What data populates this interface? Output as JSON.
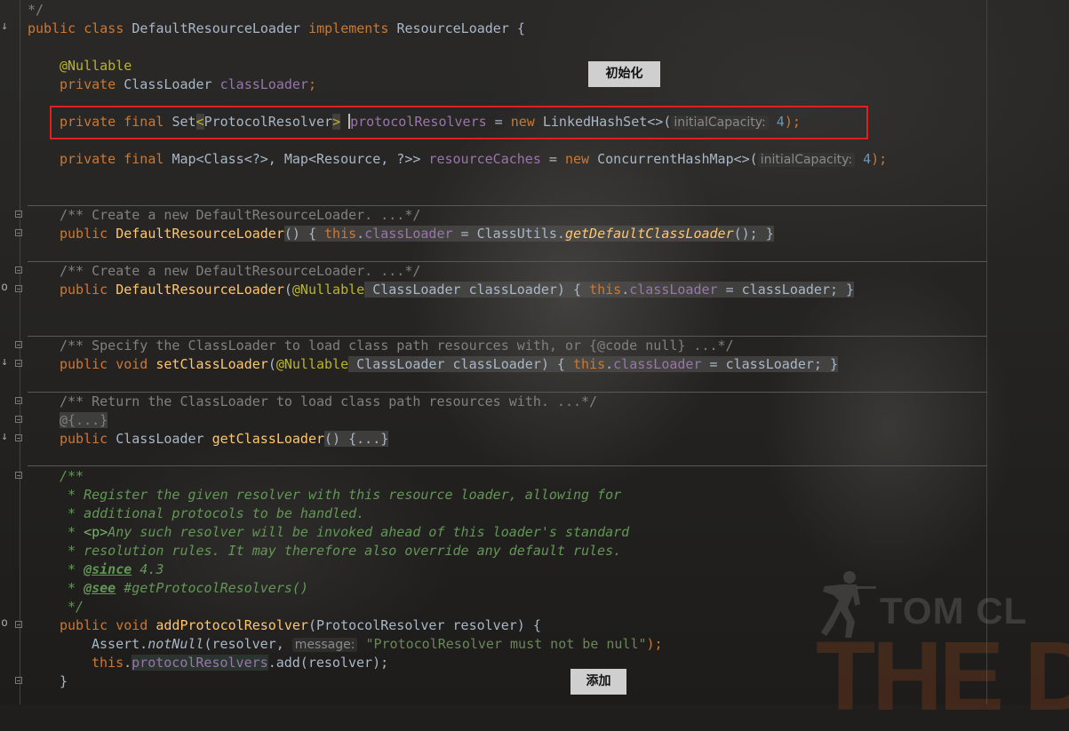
{
  "editor": {
    "lines": {
      "l00": "*/",
      "l01": [
        "public ",
        "class ",
        "DefaultResourceLoader ",
        "implements ",
        "ResourceLoader {"
      ],
      "l02": "@Nullable",
      "l03": [
        "private ",
        "ClassLoader ",
        "classLoader",
        ";"
      ],
      "l04": [
        "private final ",
        "Set",
        "<",
        "ProtocolResolver",
        ">",
        " ",
        "protocolResolvers",
        " = ",
        "new ",
        "LinkedHashSet<>(",
        "initialCapacity:",
        " 4",
        ");"
      ],
      "l05": [
        "private final ",
        "Map<Class<?>, Map<Resource, ?>> ",
        "resourceCaches",
        " = ",
        "new ",
        "ConcurrentHashMap<>(",
        "initialCapacity:",
        " 4",
        ");"
      ],
      "l06": "/** Create a new DefaultResourceLoader. ...*/",
      "l07": [
        "public ",
        "DefaultResourceLoader",
        "() { ",
        "this",
        ".",
        "classLoader",
        " = ClassUtils.",
        "getDefaultClassLoader",
        "(); }"
      ],
      "l08": "/** Create a new DefaultResourceLoader. ...*/",
      "l09": [
        "public ",
        "DefaultResourceLoader",
        "(",
        "@Nullable",
        " ClassLoader classLoader) { ",
        "this",
        ".",
        "classLoader",
        " = classLoader; }"
      ],
      "l10": "/** Specify the ClassLoader to load class path resources with, or {@code null} ...*/",
      "l11": [
        "public void ",
        "setClassLoader",
        "(",
        "@Nullable",
        " ClassLoader classLoader) { ",
        "this",
        ".",
        "classLoader",
        " = classLoader; }"
      ],
      "l12": "/** Return the ClassLoader to load class path resources with. ...*/",
      "l13": "@{...}",
      "l14": [
        "public ",
        "ClassLoader ",
        "getClassLoader",
        "() {...}"
      ],
      "l15": "/**",
      "l16": " * Register the given resolver with this resource loader, allowing for",
      "l17": " * additional protocols to be handled.",
      "l18": [
        " * ",
        "<p>",
        "Any such resolver will be invoked ahead of this loader's standard"
      ],
      "l19": " * resolution rules. It may therefore also override any default rules.",
      "l20": [
        " * ",
        "@since",
        " 4.3"
      ],
      "l21": [
        " * ",
        "@see",
        " #getProtocolResolvers()"
      ],
      "l22": " */",
      "l23": [
        "public void ",
        "addProtocolResolver",
        "(ProtocolResolver resolver) {"
      ],
      "l24": [
        "Assert.",
        "notNull",
        "(resolver, ",
        "message:",
        " \"ProtocolResolver must not be null\"",
        ");"
      ],
      "l25": [
        "this",
        ".",
        "protocolResolvers",
        ".add(resolver);"
      ],
      "l26": "}"
    }
  },
  "annotations": {
    "init_label": "初始化",
    "add_label": "添加"
  },
  "watermark": {
    "line1": "TOM CL",
    "line2": "THE D"
  },
  "colors": {
    "keyword": "#cc7832",
    "annotation": "#bbb529",
    "field": "#9876aa",
    "method": "#ffc66d",
    "string": "#6a8759",
    "number": "#6897bb",
    "comment": "#808080",
    "doc": "#629755",
    "highlight_box": "#e0201f"
  }
}
